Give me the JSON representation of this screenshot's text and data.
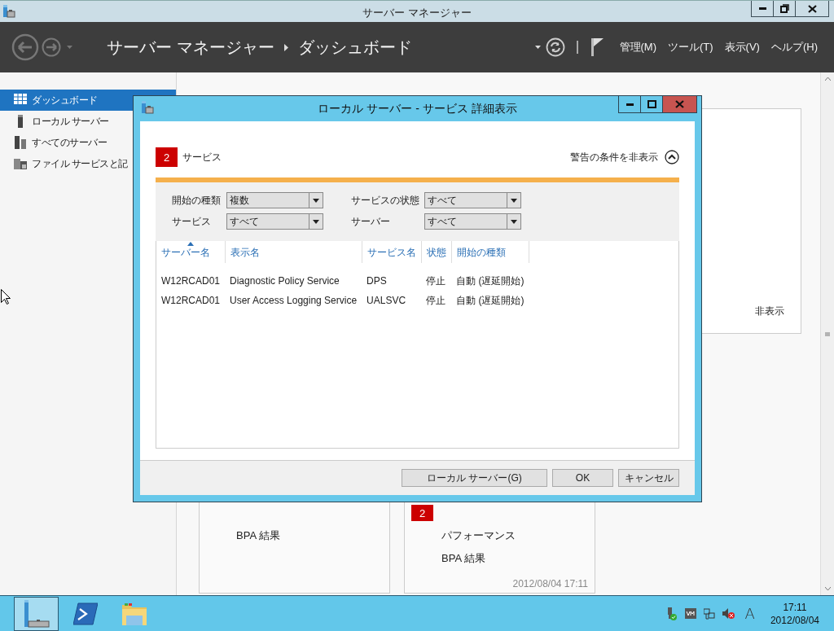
{
  "window": {
    "title": "サーバー マネージャー"
  },
  "header": {
    "breadcrumb": [
      "サーバー マネージャー",
      "ダッシュボード"
    ],
    "menus": [
      "管理(M)",
      "ツール(T)",
      "表示(V)",
      "ヘルプ(H)"
    ]
  },
  "sidebar": {
    "items": [
      {
        "label": "ダッシュボード",
        "selected": true
      },
      {
        "label": "ローカル サーバー",
        "selected": false
      },
      {
        "label": "すべてのサーバー",
        "selected": false
      },
      {
        "label": "ファイル サービスと記",
        "selected": false
      }
    ]
  },
  "dashboard": {
    "hide_link": "非表示",
    "cards": [
      {
        "items": [
          {
            "label": "BPA 結果"
          }
        ]
      },
      {
        "items": [
          {
            "badge": "2"
          },
          {
            "label": "パフォーマンス"
          },
          {
            "label": "BPA 結果"
          }
        ],
        "timestamp": "2012/08/04 17:11"
      }
    ]
  },
  "dialog": {
    "title": "ローカル サーバー - サービス 詳細表示",
    "alert_count": "2",
    "alert_label": "サービス",
    "toggle_label": "警告の条件を非表示",
    "filters": [
      {
        "label": "開始の種類",
        "value": "複数"
      },
      {
        "label": "サービスの状態",
        "value": "すべて"
      },
      {
        "label": "サービス",
        "value": "すべて"
      },
      {
        "label": "サーバー",
        "value": "すべて"
      }
    ],
    "table": {
      "columns": [
        {
          "label": "サーバー名",
          "sorted": true
        },
        {
          "label": "表示名",
          "sorted": false
        },
        {
          "label": "サービス名",
          "sorted": false
        },
        {
          "label": "状態",
          "sorted": false
        },
        {
          "label": "開始の種類",
          "sorted": false
        }
      ],
      "rows": [
        [
          "W12RCAD01",
          "Diagnostic Policy Service",
          "DPS",
          "停止",
          "自動 (遅延開始)"
        ],
        [
          "W12RCAD01",
          "User Access Logging Service",
          "UALSVC",
          "停止",
          "自動 (遅延開始)"
        ]
      ]
    },
    "buttons": [
      "ローカル サーバー(G)",
      "OK",
      "キャンセル"
    ]
  },
  "taskbar": {
    "apps": [
      {
        "kind": "server-manager",
        "selected": true
      },
      {
        "kind": "powershell",
        "selected": false
      },
      {
        "kind": "explorer",
        "selected": false
      }
    ],
    "input_indicator": "A",
    "clock": {
      "time": "17:11",
      "date": "2012/08/04"
    }
  }
}
